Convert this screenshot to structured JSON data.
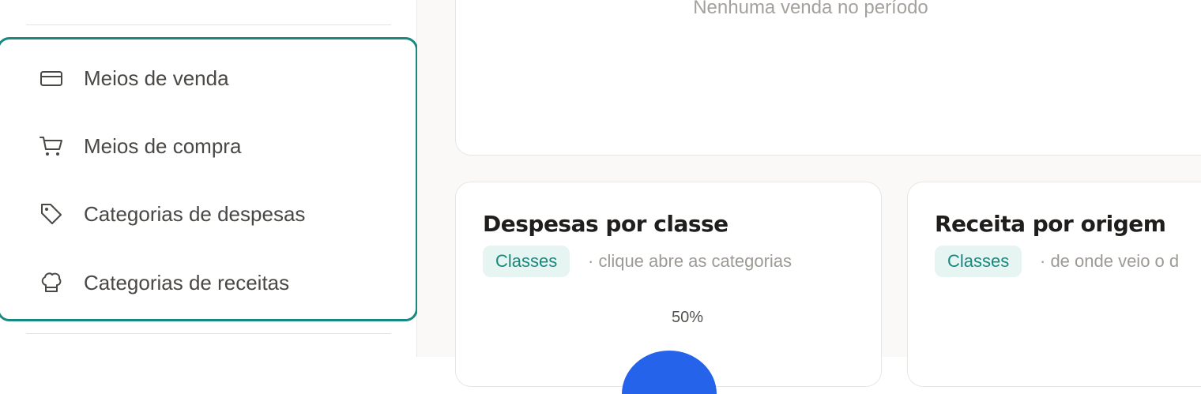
{
  "sidebar": {
    "items": [
      {
        "label": "Meios de venda",
        "icon": "credit-card-icon"
      },
      {
        "label": "Meios de compra",
        "icon": "cart-icon"
      },
      {
        "label": "Categorias de despesas",
        "icon": "tag-icon"
      },
      {
        "label": "Categorias de receitas",
        "icon": "chef-hat-icon"
      }
    ]
  },
  "sales_card": {
    "empty_message": "Nenhuma venda no período"
  },
  "expenses_card": {
    "title": "Despesas por classe",
    "badge": "Classes",
    "hint": "· clique abre as categorias",
    "pie_label": "50%"
  },
  "revenue_card": {
    "title": "Receita por origem",
    "badge": "Classes",
    "hint": "· de onde veio o d"
  },
  "colors": {
    "accent": "#17897e",
    "pie_blue": "#2563eb"
  }
}
